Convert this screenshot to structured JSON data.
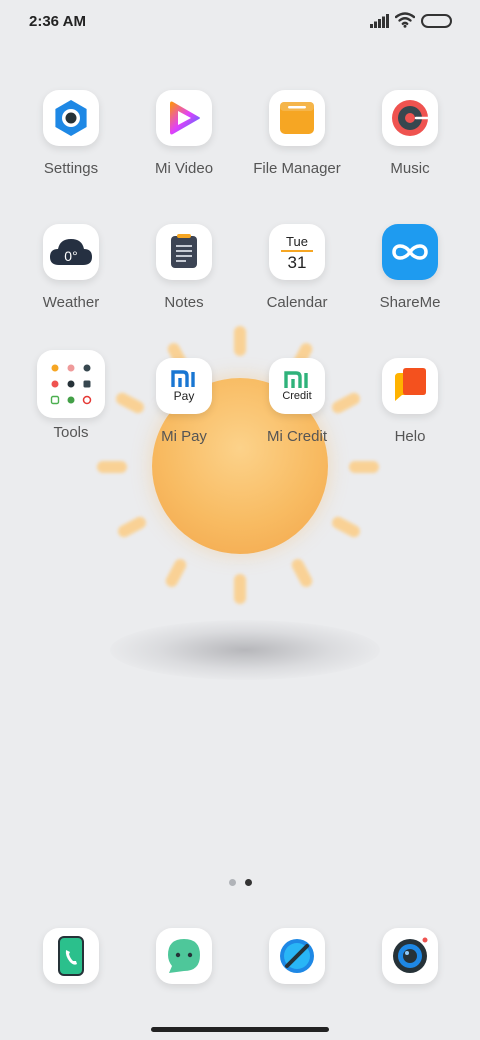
{
  "status_bar": {
    "time": "2:36 AM",
    "icons": [
      "signal-icon",
      "wifi-icon",
      "battery-icon"
    ]
  },
  "wallpaper": {
    "theme": "sun-icon"
  },
  "apps": [
    {
      "label": "Settings",
      "icon": "settings-gear-icon"
    },
    {
      "label": "Mi Video",
      "icon": "mi-video-play-icon"
    },
    {
      "label": "File Manager",
      "icon": "folder-icon"
    },
    {
      "label": "Music",
      "icon": "music-record-icon"
    },
    {
      "label": "Weather",
      "icon": "weather-cloud-icon",
      "icon_text": "0°"
    },
    {
      "label": "Notes",
      "icon": "notepad-icon"
    },
    {
      "label": "Calendar",
      "icon": "calendar-icon",
      "icon_day": "Tue",
      "icon_date": "31"
    },
    {
      "label": "ShareMe",
      "icon": "shareme-infinity-icon"
    },
    {
      "label": "Tools",
      "icon": "tools-folder-icon"
    },
    {
      "label": "Mi Pay",
      "icon": "mi-pay-icon",
      "icon_text": "Pay"
    },
    {
      "label": "Mi Credit",
      "icon": "mi-credit-icon",
      "icon_text": "Credit"
    },
    {
      "label": "Helo",
      "icon": "helo-chat-icon"
    }
  ],
  "dock": [
    {
      "name": "phone",
      "icon": "phone-icon"
    },
    {
      "name": "messages",
      "icon": "messages-icon"
    },
    {
      "name": "browser",
      "icon": "browser-compass-icon"
    },
    {
      "name": "camera",
      "icon": "camera-icon"
    }
  ],
  "page_indicator": {
    "pages": 2,
    "current": 2
  },
  "colors": {
    "background": "#ebecee",
    "settings_blue": "#1e88e5",
    "file_manager_orange": "#f6a623",
    "music_red": "#ef5350",
    "weather_navy": "#253041",
    "shareme_blue": "#1e9bf0",
    "mi_blue": "#1976d2",
    "credit_green": "#2fb27a",
    "helo_red": "#f4511e",
    "phone_green": "#2bc08c",
    "messages_green": "#4ec79a"
  }
}
